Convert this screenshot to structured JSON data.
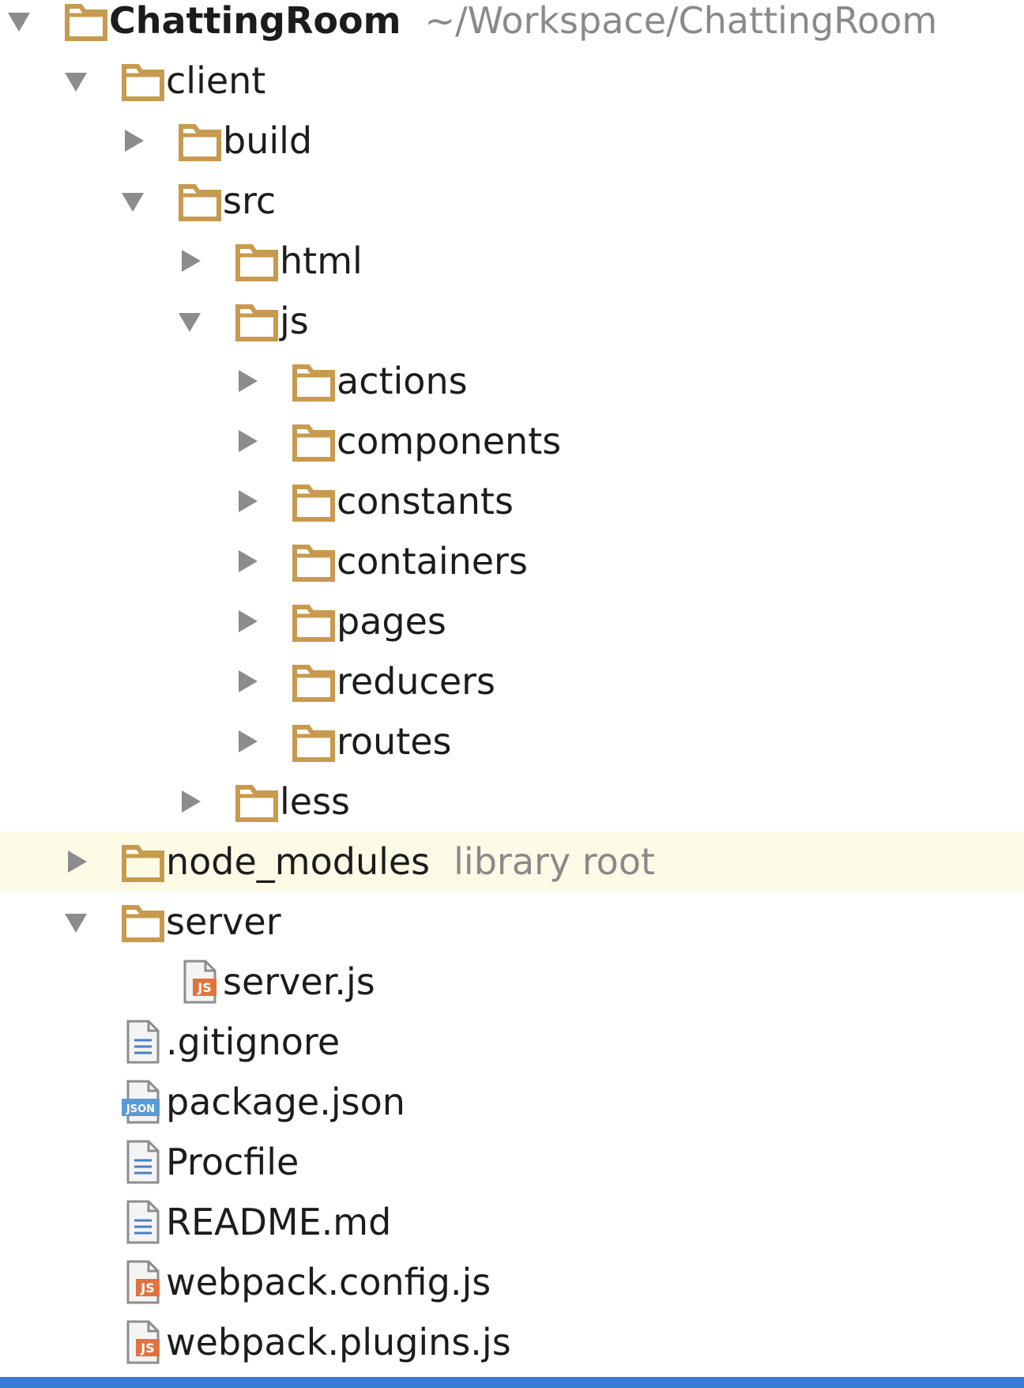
{
  "tree": [
    {
      "id": "root",
      "label": "ChattingRoom",
      "hint": "~/Workspace/ChattingRoom",
      "type": "folder",
      "arrow": "expanded",
      "depth": 0,
      "bold": true
    },
    {
      "id": "client",
      "label": "client",
      "type": "folder",
      "arrow": "expanded",
      "depth": 1
    },
    {
      "id": "build",
      "label": "build",
      "type": "folder",
      "arrow": "collapsed",
      "depth": 2
    },
    {
      "id": "src",
      "label": "src",
      "type": "folder",
      "arrow": "expanded",
      "depth": 2
    },
    {
      "id": "html",
      "label": "html",
      "type": "folder",
      "arrow": "collapsed",
      "depth": 3
    },
    {
      "id": "js",
      "label": "js",
      "type": "folder",
      "arrow": "expanded",
      "depth": 3
    },
    {
      "id": "actions",
      "label": "actions",
      "type": "folder",
      "arrow": "collapsed",
      "depth": 4
    },
    {
      "id": "components",
      "label": "components",
      "type": "folder",
      "arrow": "collapsed",
      "depth": 4
    },
    {
      "id": "constants",
      "label": "constants",
      "type": "folder",
      "arrow": "collapsed",
      "depth": 4
    },
    {
      "id": "containers",
      "label": "containers",
      "type": "folder",
      "arrow": "collapsed",
      "depth": 4
    },
    {
      "id": "pages",
      "label": "pages",
      "type": "folder",
      "arrow": "collapsed",
      "depth": 4
    },
    {
      "id": "reducers",
      "label": "reducers",
      "type": "folder",
      "arrow": "collapsed",
      "depth": 4
    },
    {
      "id": "routes",
      "label": "routes",
      "type": "folder",
      "arrow": "collapsed",
      "depth": 4
    },
    {
      "id": "less",
      "label": "less",
      "type": "folder",
      "arrow": "collapsed",
      "depth": 3
    },
    {
      "id": "node-modules",
      "label": "node_modules",
      "hint": "library root",
      "type": "folder",
      "arrow": "collapsed",
      "depth": 1,
      "highlighted": true
    },
    {
      "id": "server",
      "label": "server",
      "type": "folder",
      "arrow": "expanded",
      "depth": 1
    },
    {
      "id": "server-js",
      "label": "server.js",
      "type": "js-file",
      "arrow": "none",
      "depth": 2
    },
    {
      "id": "gitignore",
      "label": ".gitignore",
      "type": "text-file",
      "arrow": "none",
      "depth": 1
    },
    {
      "id": "package-json",
      "label": "package.json",
      "type": "json-file",
      "arrow": "none",
      "depth": 1
    },
    {
      "id": "procfile",
      "label": "Procfile",
      "type": "text-file",
      "arrow": "none",
      "depth": 1
    },
    {
      "id": "readme",
      "label": "README.md",
      "type": "text-file",
      "arrow": "none",
      "depth": 1
    },
    {
      "id": "webpack-config",
      "label": "webpack.config.js",
      "type": "js-file",
      "arrow": "none",
      "depth": 1
    },
    {
      "id": "webpack-plugins",
      "label": "webpack.plugins.js",
      "type": "js-file",
      "arrow": "none",
      "depth": 1
    }
  ],
  "icons": {
    "folder": "folder-icon",
    "js-file": "js-file-icon",
    "text-file": "text-file-icon",
    "json-file": "json-file-icon",
    "expanded": "triangle-down-icon",
    "collapsed": "triangle-right-icon"
  },
  "colors": {
    "folder": "#c79a4f",
    "arrow": "#8c8c8c",
    "hint_text": "#8a8a8a",
    "highlight_row": "#fdfbe6",
    "selection_bar": "#3c7bd4",
    "js_badge": "#e0733d",
    "json_badge": "#5b9bd5",
    "text_lines": "#4a7fc1"
  }
}
